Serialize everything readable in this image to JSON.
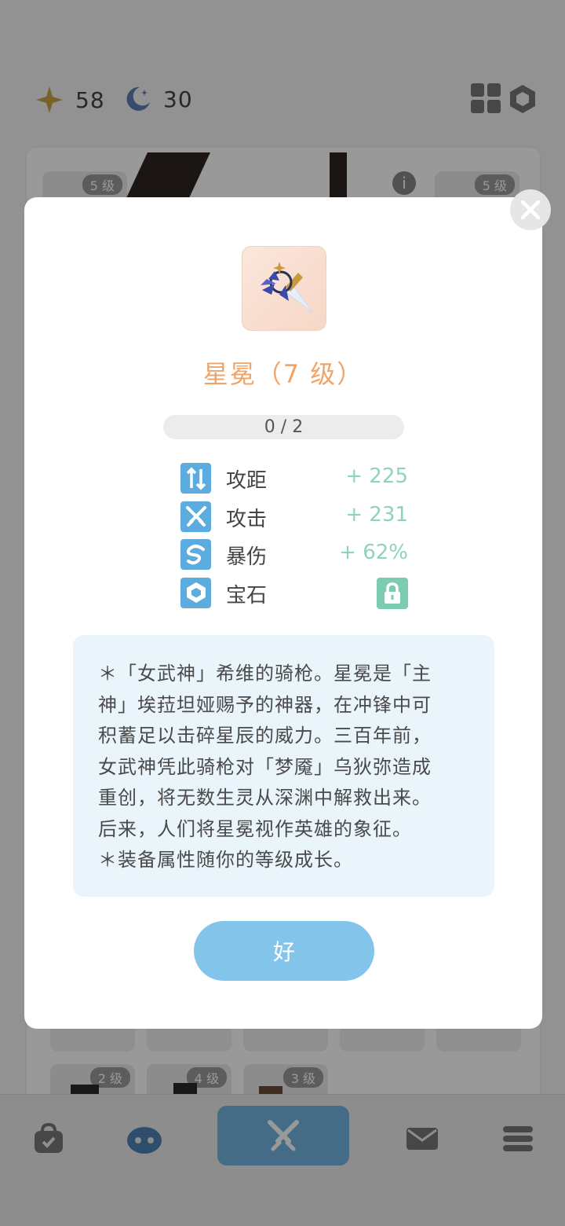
{
  "header": {
    "star_count": "58",
    "moon_count": "30"
  },
  "inventory": {
    "slots": [
      {
        "level": "5 级"
      },
      {
        "level": "5 级"
      },
      {
        "level": "2 级"
      },
      {
        "level": "4 级"
      },
      {
        "level": "3 级"
      }
    ]
  },
  "modal": {
    "title": "星冕（7 级）",
    "progress_text": "0 / 2",
    "progress_value": 0,
    "stats": [
      {
        "icon": "range-icon",
        "name": "攻距",
        "value": "+ 225"
      },
      {
        "icon": "attack-icon",
        "name": "攻击",
        "value": "+ 231"
      },
      {
        "icon": "crit-icon",
        "name": "暴伤",
        "value": "+ 62%"
      },
      {
        "icon": "gem-icon",
        "name": "宝石",
        "value_icon": "lock-icon"
      }
    ],
    "description": [
      "＊「女武神」希维的骑枪。星冕是「主",
      "神」埃菈坦娅赐予的神器，在冲锋中可",
      "积蓄足以击碎星辰的威力。三百年前，",
      "女武神凭此骑枪对「梦魇」乌狄弥造成",
      "重创，将无数生灵从深渊中解救出来。",
      "后来，人们将星冕视作英雄的象征。",
      "＊装备属性随你的等级成长。"
    ],
    "ok_label": "好"
  },
  "colors": {
    "accent_blue": "#82c4ea",
    "title_orange": "#f0a468",
    "stat_green": "#8fd3bd",
    "icon_blue": "#5dace0"
  }
}
